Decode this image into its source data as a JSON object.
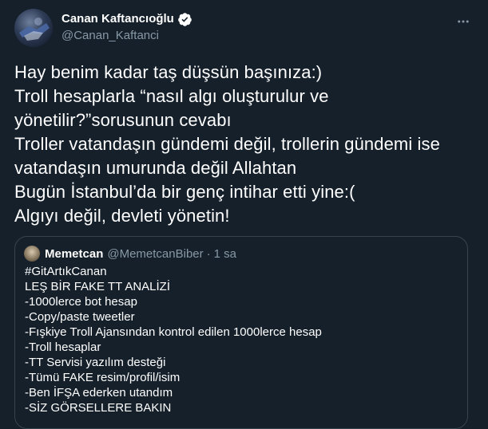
{
  "author": {
    "display_name": "Canan Kaftancıoğlu",
    "handle": "@Canan_Kaftanci"
  },
  "icons": {
    "verified": "verified-badge-icon",
    "more": "more-options-icon"
  },
  "tweet": {
    "lines": [
      "Hay benim kadar taş düşsün başınıza:)",
      "Troll hesaplarla “nasıl algı oluşturulur ve",
      "yönetilir?”sorusunun cevabı",
      "Troller vatandaşın gündemi değil, trollerin gündemi ise",
      "vatandaşın umurunda değil Allahtan",
      "Bugün İstanbul’da  bir genç intihar etti yine:(",
      "Algıyı değil, devleti yönetin!"
    ]
  },
  "quoted_tweet": {
    "display_name": "Memetcan",
    "handle": "@MemetcanBiber",
    "separator": "·",
    "time": "1 sa",
    "lines": [
      "#GitArtıkCanan",
      "LEŞ BİR FAKE TT ANALİZİ",
      "-1000lerce bot hesap",
      "-Copy/paste tweetler",
      "-Fışkiye Troll Ajansından kontrol edilen 1000lerce hesap",
      "-Troll hesaplar",
      "-TT Servisi yazılım desteği",
      "-Tümü FAKE resim/profil/isim",
      "-Ben İFŞA ederken utandım",
      "-SİZ GÖRSELLERE BAKIN"
    ]
  },
  "colors": {
    "background": "#15202b",
    "secondary_text": "#8899a6",
    "border": "#38444d",
    "verified_badge": "#ffffff"
  }
}
